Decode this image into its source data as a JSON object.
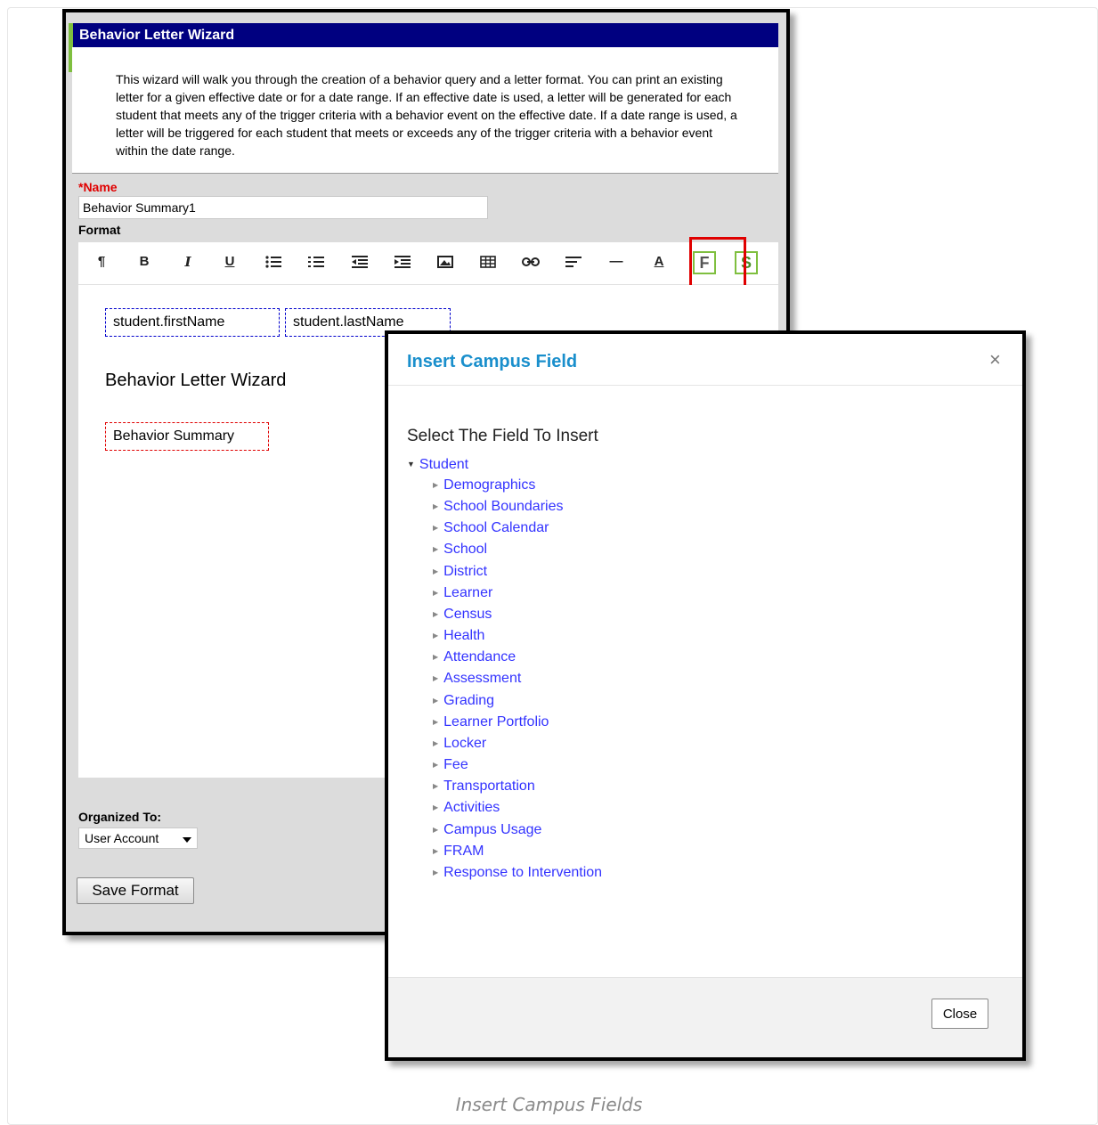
{
  "wizard": {
    "title": "Behavior Letter Wizard",
    "intro": "This wizard will walk you through the creation of a behavior query and a letter format. You can print an existing letter for a given effective date or for a date range. If an effective date is used, a letter will be generated for each student that meets any of the trigger criteria with a behavior event on the effective date. If a date range is used, a letter will be triggered for each student that meets or exceeds any of the trigger criteria with a behavior event within the date range.",
    "name_label": "*Name",
    "name_value": "Behavior Summary1",
    "format_label": "Format",
    "toolbar": {
      "paragraph": "¶",
      "bold": "B",
      "italic": "I",
      "underline": "U",
      "bullet_list": "≔",
      "numbered_list": "≔",
      "outdent": "⇤",
      "indent": "⇥",
      "image": "▭",
      "table": "⊞",
      "link": "⊂⊃",
      "align": "≡",
      "hr": "—",
      "font_color": "A",
      "field": "F",
      "sub_report": "S"
    },
    "editor": {
      "first_name": "student.firstName",
      "last_name": "student.lastName",
      "heading": "Behavior Letter Wizard",
      "summary": "Behavior Summary"
    },
    "organized_label": "Organized To:",
    "organized_value": "User Account",
    "save_label": "Save Format"
  },
  "modal": {
    "title": "Insert Campus Field",
    "close_x": "×",
    "subtitle": "Select The Field To Insert",
    "root": "Student",
    "items": [
      "Demographics",
      "School Boundaries",
      "School Calendar",
      "School",
      "District",
      "Learner",
      "Census",
      "Health",
      "Attendance",
      "Assessment",
      "Grading",
      "Learner Portfolio",
      "Locker",
      "Fee",
      "Transportation",
      "Activities",
      "Campus Usage",
      "FRAM",
      "Response to Intervention"
    ],
    "close_label": "Close"
  },
  "caption": "Insert Campus Fields",
  "colors": {
    "title_bar": "#000080",
    "modal_title": "#1a8fcc",
    "link": "#3333ff",
    "highlight": "#e00000",
    "accent_green": "#7fbf3f"
  }
}
